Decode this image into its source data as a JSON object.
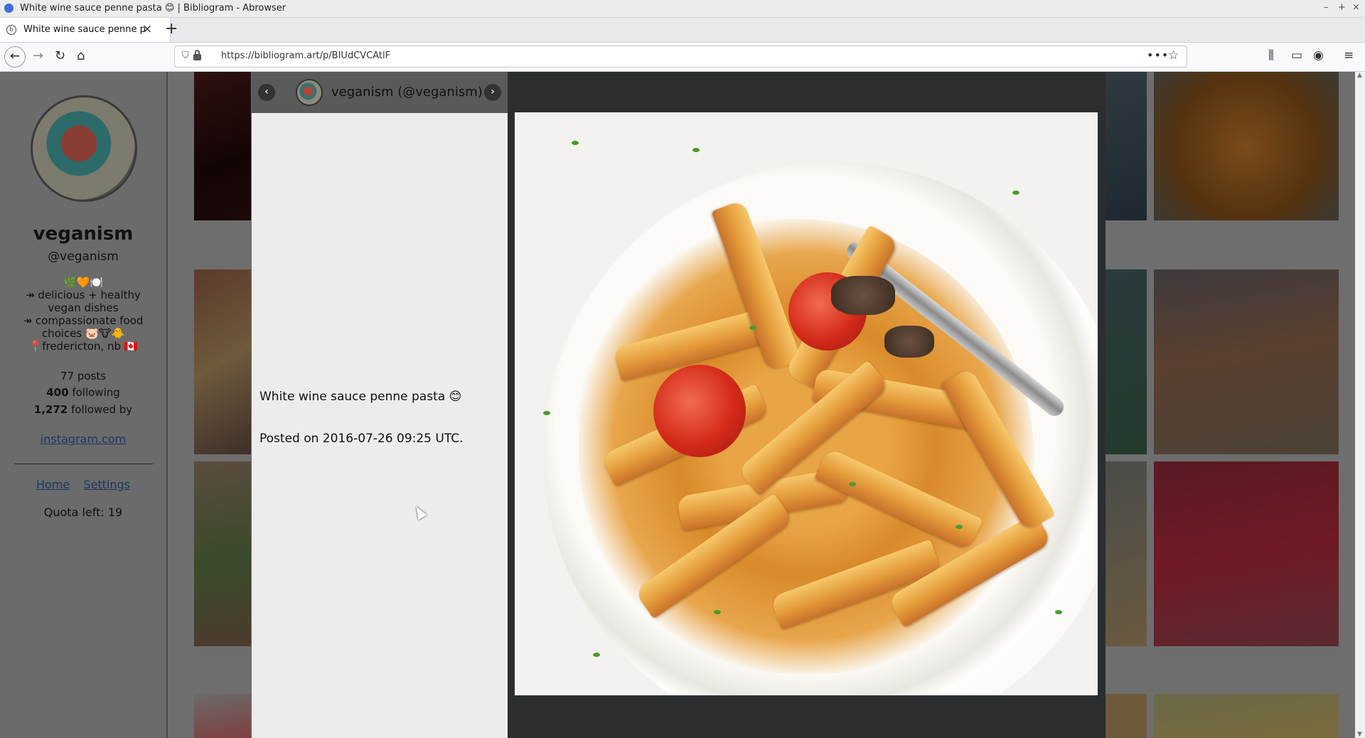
{
  "window": {
    "title": "White wine sauce penne pasta 😊 | Bibliogram - Abrowser",
    "controls": [
      "–",
      "+",
      "×"
    ]
  },
  "tab": {
    "label": "White wine sauce penne pasta",
    "close": "×",
    "new_tab": "+"
  },
  "nav": {
    "back": "←",
    "forward": "→",
    "reload": "↻",
    "home": "⌂",
    "url": "https://bibliogram.art/p/BIUdCVCAtlF",
    "more": "•••",
    "bookmark_star": "☆",
    "library": "⫼",
    "sidebar_toggle": "▭",
    "account": "◉",
    "menu": "≡"
  },
  "profile": {
    "name": "veganism",
    "handle": "@veganism",
    "bio_lines": [
      "🌿🧡🍽️",
      "↠ delicious + healthy vegan dishes",
      "↠ compassionate food choices 🐷🐮🐥",
      "📍fredericton, nb 🇨🇦"
    ],
    "posts_count": "77",
    "posts_label": "posts",
    "following_count": "400",
    "following_label": "following",
    "followers_count": "1,272",
    "followers_label": "followed by",
    "external_link": "instagram.com",
    "home_link": "Home",
    "settings_link": "Settings",
    "quota": "Quota left: 19"
  },
  "post": {
    "header_title": "veganism (@veganism)",
    "prev": "‹",
    "next": "›",
    "caption": "White wine sauce penne pasta 😊",
    "posted": "Posted on 2016-07-26 09:25 UTC."
  },
  "colors": {
    "overlay_dim": "#6e6e6e",
    "modal_dark": "#2c2d30",
    "link": "#1d3766"
  }
}
